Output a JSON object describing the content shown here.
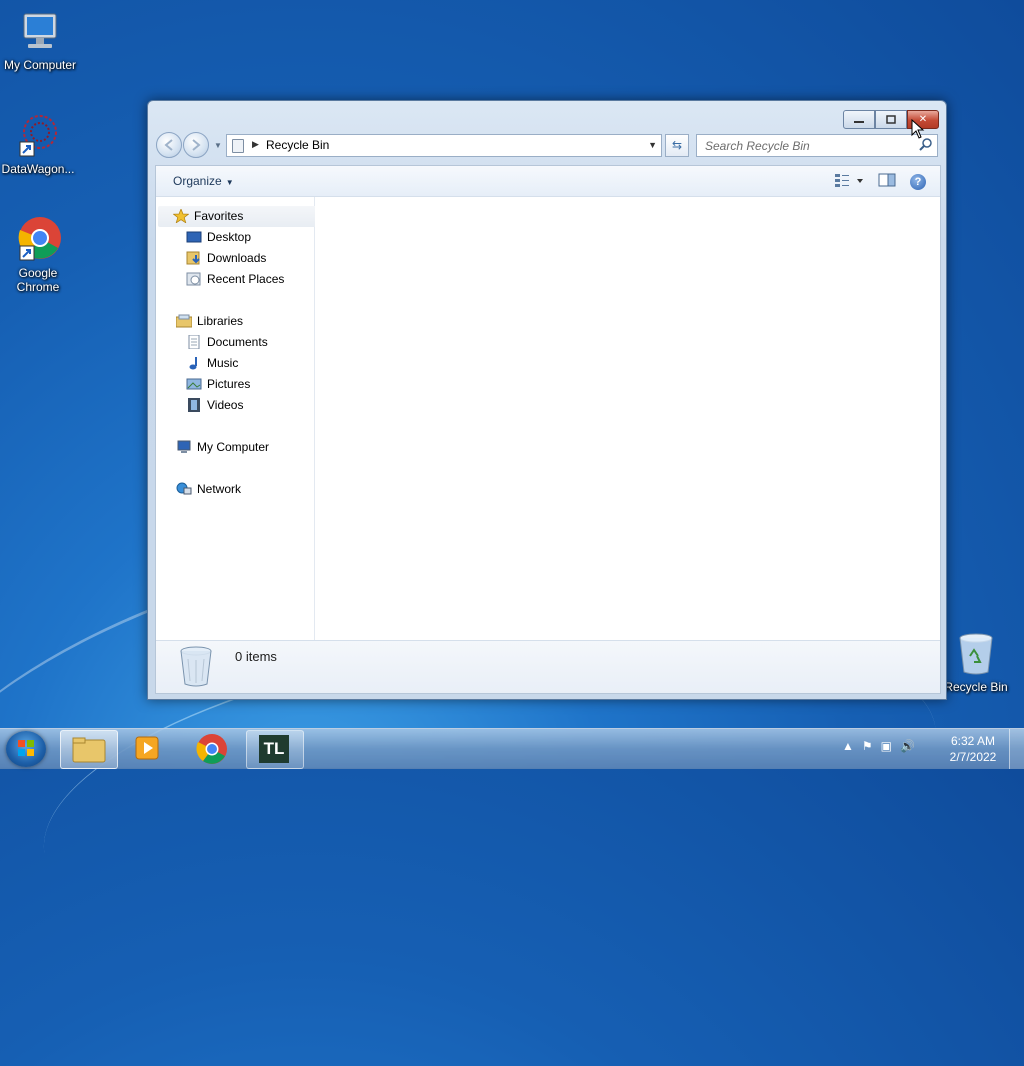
{
  "desktop": {
    "icons": [
      {
        "label": "My Computer"
      },
      {
        "label": "DataWagon..."
      },
      {
        "label": "Google Chrome"
      },
      {
        "label": "Recycle Bin"
      }
    ]
  },
  "window": {
    "address": {
      "path": "Recycle Bin"
    },
    "search": {
      "placeholder": "Search Recycle Bin"
    },
    "toolbar": {
      "organize_label": "Organize"
    },
    "nav": {
      "favorites": {
        "label": "Favorites",
        "items": [
          "Desktop",
          "Downloads",
          "Recent Places"
        ]
      },
      "libraries": {
        "label": "Libraries",
        "items": [
          "Documents",
          "Music",
          "Pictures",
          "Videos"
        ]
      },
      "computer": {
        "label": "My Computer"
      },
      "network": {
        "label": "Network"
      }
    },
    "details": {
      "count_text": "0 items"
    }
  },
  "taskbar": {
    "clock": {
      "time": "6:32 AM",
      "date": "2/7/2022"
    },
    "apps": [
      "Windows Explorer",
      "Media Player",
      "Google Chrome",
      "TL"
    ],
    "tl_text": "TL"
  },
  "colors": {
    "accent": "#1e395b",
    "close_button": "#c44a35",
    "desktop": "#1f74c9"
  }
}
